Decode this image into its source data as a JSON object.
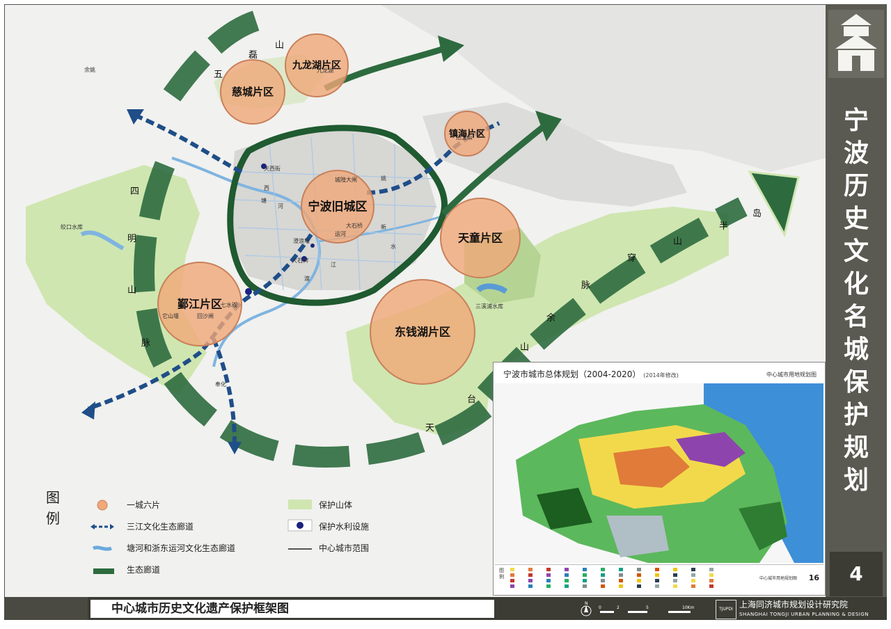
{
  "side_title": "宁波历史文化名城保护规划",
  "page_number": "4",
  "footer": {
    "title": "中心城市历史文化遗产保护框架图",
    "institute_cn": "上海同济城市规划设计研究院",
    "institute_en": "SHANGHAI TONGJI URBAN PLANNING & DESIGN INSTITUTE",
    "institute_logo_text": "TJUPDI",
    "north_label": "N",
    "scale_labels": [
      "0",
      "2",
      "5",
      "10Km"
    ]
  },
  "zones": [
    {
      "label": "宁波旧城区"
    },
    {
      "label": "慈城片区"
    },
    {
      "label": "九龙湖片区"
    },
    {
      "label": "镇海片区"
    },
    {
      "label": "天童片区"
    },
    {
      "label": "鄞江片区"
    },
    {
      "label": "东钱湖片区"
    }
  ],
  "corridor_chars": {
    "north": [
      "五",
      "磊",
      "山"
    ],
    "west": [
      "四",
      "明",
      "山",
      "脉"
    ],
    "south": [
      "天",
      "台",
      "山",
      "余",
      "脉"
    ],
    "east": [
      "穿",
      "山",
      "半",
      "岛"
    ]
  },
  "place_labels": [
    "九龙湖",
    "招宝山",
    "天西街",
    "城隍大闸",
    "大石桥",
    "运河",
    "澄浪堰",
    "大石牌",
    "它山堰",
    "回沙闸",
    "七水碶",
    "皎口水库",
    "三溪浦水库",
    "余姚",
    "奉化",
    "西",
    "塘",
    "河",
    "江",
    "渡",
    "姚",
    "新",
    "水"
  ],
  "legend": {
    "title": "图例",
    "items": [
      {
        "label": "一城六片",
        "type": "circle",
        "color": "#f0a878"
      },
      {
        "label": "三江文化生态廊道",
        "type": "dashed-arrow",
        "color": "#1f4e88"
      },
      {
        "label": "塘河和浙东运河文化生态廊道",
        "type": "river",
        "color": "#6aa9dd"
      },
      {
        "label": "生态廊道",
        "type": "green-band",
        "color": "#2d6b3f"
      },
      {
        "label": "保护山体",
        "type": "fill",
        "color": "#cfe6b0"
      },
      {
        "label": "保护水利设施",
        "type": "dot",
        "color": "#1a237e"
      },
      {
        "label": "中心城市范围",
        "type": "line",
        "color": "#555555"
      }
    ]
  },
  "inset": {
    "title": "宁波市城市总体规划（2004-2020）",
    "subtitle": "(2014年修改)",
    "right_label": "中心城市用地规划图",
    "legend_label": "图例",
    "legend_note": "中心城市用地规划图",
    "number": "16"
  },
  "colors": {
    "sidebar": "#5a5a52",
    "footer": "#3c3c35",
    "mountain": "#cfe6b0",
    "eco_corridor": "#2d6b3f",
    "zone": "#f0a878",
    "river_corridor": "#1f4e88"
  }
}
